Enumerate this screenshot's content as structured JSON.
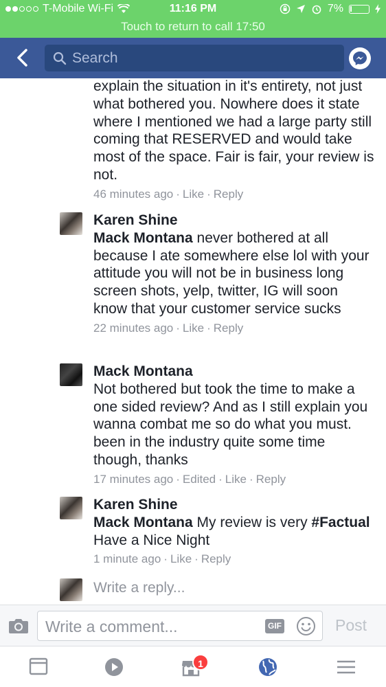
{
  "status_bar": {
    "carrier": "T-Mobile Wi-Fi",
    "time": "11:16 PM",
    "battery": "7%",
    "battery_level": 0.07,
    "return_call": "Touch to return to call 17:50"
  },
  "nav": {
    "search_placeholder": "Search",
    "back_icon": "chevron-left-icon",
    "messenger_icon": "messenger-icon"
  },
  "comments": [
    {
      "name": "",
      "mention": "",
      "text": "explain the situation in it's entirety, not just what bothered you. Nowhere does it state where I mentioned we had a large party still coming that RESERVED and would take most of the space. Fair is fair, your review is not.",
      "time": "46 minutes ago",
      "edited": "",
      "like": "Like",
      "reply": "Reply"
    },
    {
      "name": "Karen Shine",
      "mention": "Mack Montana",
      "text": "never bothered at all because I ate somewhere else lol with your attitude you will not be in business long screen shots, yelp, twitter, IG will soon know that your customer service sucks",
      "time": "22 minutes ago",
      "edited": "",
      "like": "Like",
      "reply": "Reply"
    },
    {
      "name": "Mack Montana",
      "mention": "",
      "text": "Not bothered but took the time to make a one sided review? And as I still explain you wanna combat me so do what you must. been in the industry quite some time though, thanks",
      "time": "17 minutes ago",
      "edited": "Edited",
      "like": "Like",
      "reply": "Reply"
    },
    {
      "name": "Karen Shine",
      "mention": "Mack Montana",
      "text": "My review is very",
      "hashtag": "#Factual",
      "text2": "Have a Nice Night",
      "time": "1 minute ago",
      "edited": "",
      "like": "Like",
      "reply": "Reply"
    }
  ],
  "reply_placeholder": "Write a reply...",
  "composer": {
    "placeholder": "Write a comment...",
    "gif_label": "GIF",
    "post_label": "Post"
  },
  "tab_bar": {
    "marketplace_badge": "1"
  },
  "colors": {
    "call_bar": "#6cd36b",
    "nav_bar": "#3b5998",
    "badge": "#fa3e3e",
    "meta_text": "#90949c"
  }
}
